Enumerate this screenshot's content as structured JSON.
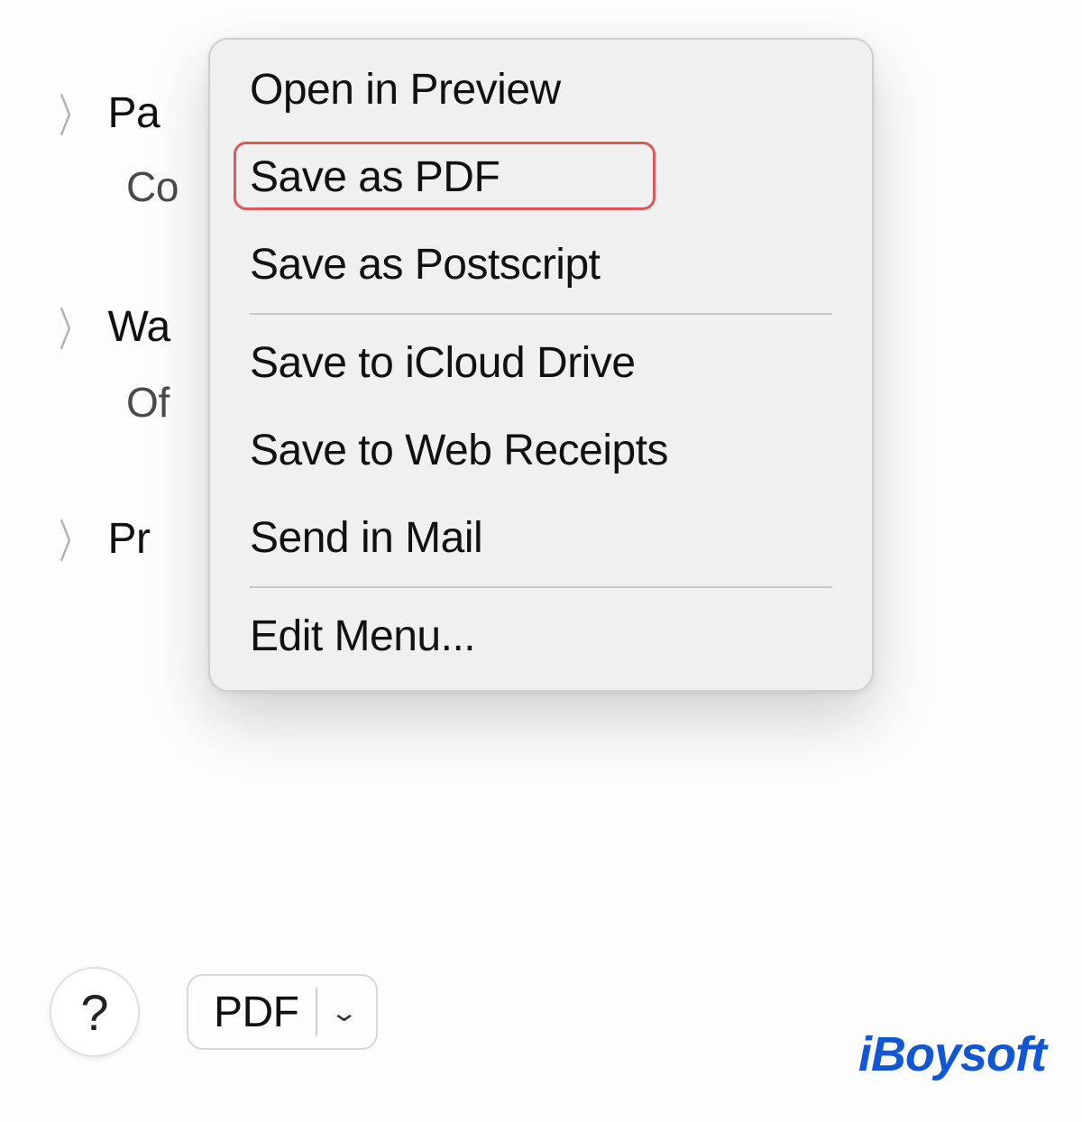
{
  "background": {
    "rows": [
      {
        "type": "main",
        "text": "Pa"
      },
      {
        "type": "sub",
        "text": "Co"
      },
      {
        "type": "main",
        "text": "Wa"
      },
      {
        "type": "sub",
        "text": "Of"
      },
      {
        "type": "main",
        "text": "Pr"
      }
    ]
  },
  "menu": {
    "items": [
      {
        "label": "Open in Preview",
        "highlighted": false
      },
      {
        "label": "Save as PDF",
        "highlighted": true
      },
      {
        "label": "Save as Postscript",
        "highlighted": false
      },
      {
        "label": "Save to iCloud Drive",
        "highlighted": false
      },
      {
        "label": "Save to Web Receipts",
        "highlighted": false
      },
      {
        "label": "Send in Mail",
        "highlighted": false
      },
      {
        "label": "Edit Menu...",
        "highlighted": false
      }
    ],
    "highlight_color": "#d85a5a"
  },
  "toolbar": {
    "help_label": "?",
    "pdf_button_label": "PDF"
  },
  "watermark": {
    "text": "iBoysoft"
  }
}
